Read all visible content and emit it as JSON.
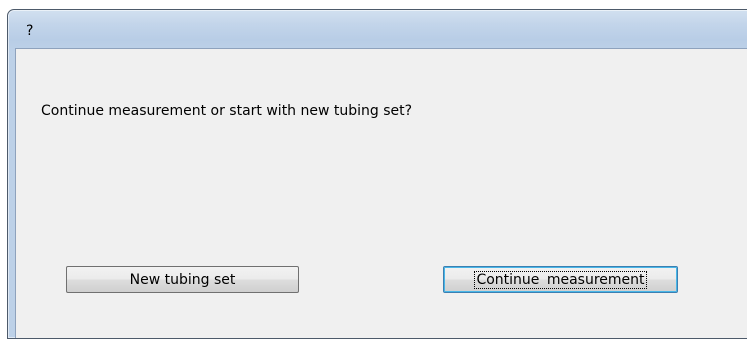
{
  "window": {
    "title": "?"
  },
  "dialog": {
    "message": "Continue measurement or start with new tubing set?"
  },
  "buttons": {
    "new_tubing_set": "New tubing set",
    "continue_measurement": "Continue measurement"
  }
}
